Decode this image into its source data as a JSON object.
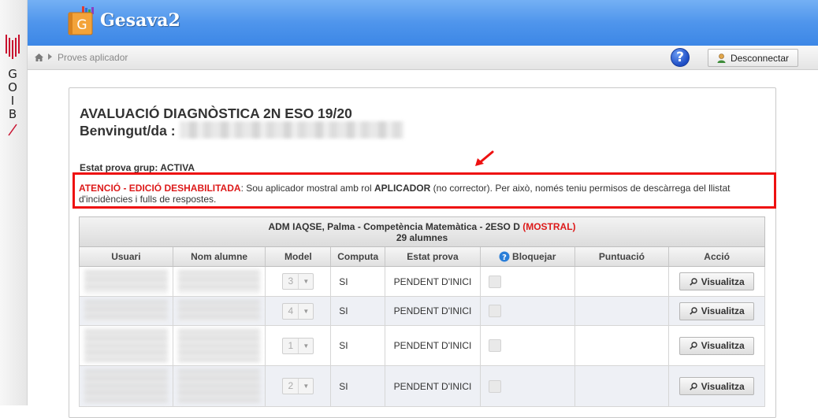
{
  "sidebar": {
    "letters": [
      "G",
      "O",
      "I",
      "B"
    ]
  },
  "header": {
    "app_title": "Gesava2",
    "app_icon_letter": "G"
  },
  "breadcrumb": {
    "current": "Proves aplicador"
  },
  "toolbar": {
    "help_label": "?",
    "logout_label": "Desconnectar"
  },
  "page": {
    "title": "AVALUACIÓ DIAGNÒSTICA 2N ESO 19/20",
    "welcome_label": "Benvingut/da :",
    "status_text": "Estat prova grup: ACTIVA"
  },
  "warning": {
    "label": "ATENCIÓ - EDICIÓ DESHABILITADA",
    "text_1": ": Sou aplicador mostral amb rol ",
    "role": "APLICADOR",
    "text_2": " (no corrector). Per això, només teniu permisos de descàrrega del llistat d'incidències i fulls de respostes."
  },
  "table": {
    "caption_line1": "ADM IAQSE, Palma - Competència Matemàtica - 2ESO D",
    "caption_tag": "(MOSTRAL)",
    "caption_line2": "29 alumnes",
    "headers": [
      "Usuari",
      "Nom alumne",
      "Model",
      "Computa",
      "Estat prova",
      "Bloquejar",
      "Puntuació",
      "Acció"
    ],
    "rows": [
      {
        "model": "3",
        "computa": "SI",
        "estat": "PENDENT D'INICI",
        "puntuacio": "",
        "accio": "Visualitza"
      },
      {
        "model": "4",
        "computa": "SI",
        "estat": "PENDENT D'INICI",
        "puntuacio": "",
        "accio": "Visualitza"
      },
      {
        "model": "1",
        "computa": "SI",
        "estat": "PENDENT D'INICI",
        "puntuacio": "",
        "accio": "Visualitza"
      },
      {
        "model": "2",
        "computa": "SI",
        "estat": "PENDENT D'INICI",
        "puntuacio": "",
        "accio": "Visualitza"
      }
    ]
  },
  "colors": {
    "header_blue": "#4f95ec",
    "warning_red": "#ee1111",
    "mostral_red": "#dd1a1a"
  }
}
